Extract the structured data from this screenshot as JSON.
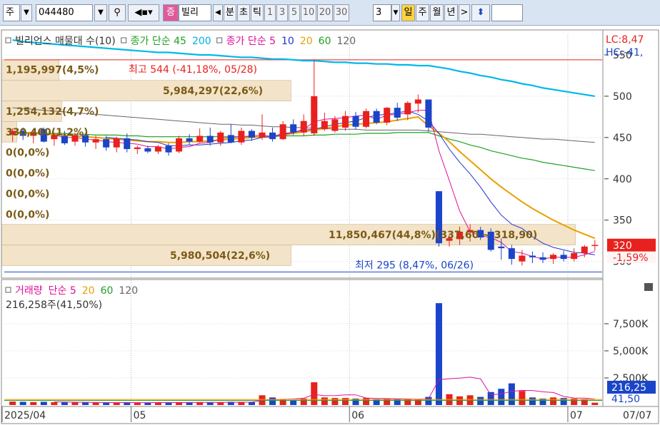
{
  "toolbar": {
    "market_btn": "주",
    "code_value": "044480",
    "stock_badge": "증",
    "stock_name": "빌리",
    "period_buttons": [
      "분",
      "초",
      "틱",
      "1",
      "3",
      "5",
      "10",
      "20",
      "30"
    ],
    "period_count": "3",
    "period_tabs": [
      "일",
      "주",
      "월",
      "년"
    ]
  },
  "legend": {
    "price_legend": [
      {
        "text": "빌리언스 매물대 수(10)",
        "color": "#333333"
      },
      {
        "text": "종가 단순 45",
        "color": "#22a022"
      },
      {
        "text": "200",
        "color": "#00b0e0"
      },
      {
        "text": "종가 단순 5",
        "color": "#e0109a"
      },
      {
        "text": "10",
        "color": "#2233cc"
      },
      {
        "text": "20",
        "color": "#e8a000"
      },
      {
        "text": "60",
        "color": "#22a022"
      },
      {
        "text": "120",
        "color": "#666666"
      }
    ],
    "lc_label": "LC:8,47",
    "hc_label": "HC:-41,"
  },
  "colors": {
    "up": "#e8211e",
    "down": "#1a45c8",
    "vp_band": "#f3e3c8",
    "ma5": "#e0109a",
    "ma10": "#2233cc",
    "ma20": "#e8a000",
    "ma60": "#22a022",
    "ma120": "#666666",
    "ma200": "#00b8e8"
  },
  "volume_profile": [
    {
      "label": "1,195,997(4,5%)",
      "pct": 4.5
    },
    {
      "label": "5,984,297(22,6%)",
      "pct": 22.6
    },
    {
      "label": "1,254,132(4,7%)",
      "pct": 4.7
    },
    {
      "label": "330,460(1,2%)",
      "pct": 1.2
    },
    {
      "label": "0(0,0%)",
      "pct": 0.0
    },
    {
      "label": "0(0,0%)",
      "pct": 0.0
    },
    {
      "label": "0(0,0%)",
      "pct": 0.0
    },
    {
      "label": "0(0,0%)",
      "pct": 0.0
    },
    {
      "label": "11,850,467(44,8%)(337,60 ~ 318,90)",
      "pct": 44.8
    },
    {
      "label": "5,980,504(22,6%)",
      "pct": 22.6
    }
  ],
  "annotations": {
    "high": "최고 544 (-41,18%, 05/28)",
    "low": "최저 295 (8,47%, 06/26)"
  },
  "price_axis": {
    "ticks": [
      "550",
      "500",
      "450",
      "400",
      "350"
    ],
    "current": "320",
    "current_pct": "-1,59%",
    "partial_tick": "300"
  },
  "volume_legend": [
    {
      "text": "거래량",
      "color": "#e0109a"
    },
    {
      "text": "단순 5",
      "color": "#e0109a"
    },
    {
      "text": "20",
      "color": "#e8a000"
    },
    {
      "text": "60",
      "color": "#22a022"
    },
    {
      "text": "120",
      "color": "#666666"
    }
  ],
  "volume_info": "216,258주(41,50%)",
  "volume_axis": {
    "ticks": [
      "7,500K",
      "5,000K",
      "2,500K"
    ],
    "current": "216,25",
    "current_pct": "41,50"
  },
  "date_axis": {
    "labels": [
      "2025/04",
      "05",
      "06",
      "07"
    ],
    "current_date": "07/07"
  },
  "chart_data": {
    "type": "candlestick",
    "price_range": [
      285,
      575
    ],
    "volume_range": [
      0,
      10000000
    ],
    "high": 544,
    "low": 295,
    "candles": [
      {
        "o": 453,
        "h": 461,
        "l": 445,
        "c": 458
      },
      {
        "o": 458,
        "h": 462,
        "l": 447,
        "c": 452
      },
      {
        "o": 452,
        "h": 459,
        "l": 443,
        "c": 456
      },
      {
        "o": 460,
        "h": 462,
        "l": 444,
        "c": 445
      },
      {
        "o": 448,
        "h": 455,
        "l": 440,
        "c": 453
      },
      {
        "o": 452,
        "h": 458,
        "l": 441,
        "c": 443
      },
      {
        "o": 445,
        "h": 456,
        "l": 440,
        "c": 453
      },
      {
        "o": 453,
        "h": 455,
        "l": 439,
        "c": 444
      },
      {
        "o": 444,
        "h": 452,
        "l": 436,
        "c": 448
      },
      {
        "o": 448,
        "h": 452,
        "l": 434,
        "c": 438
      },
      {
        "o": 438,
        "h": 451,
        "l": 432,
        "c": 449
      },
      {
        "o": 449,
        "h": 455,
        "l": 432,
        "c": 436
      },
      {
        "o": 436,
        "h": 440,
        "l": 430,
        "c": 438
      },
      {
        "o": 437,
        "h": 440,
        "l": 431,
        "c": 433
      },
      {
        "o": 433,
        "h": 441,
        "l": 430,
        "c": 439
      },
      {
        "o": 440,
        "h": 443,
        "l": 428,
        "c": 432
      },
      {
        "o": 433,
        "h": 452,
        "l": 431,
        "c": 449
      },
      {
        "o": 449,
        "h": 454,
        "l": 441,
        "c": 445
      },
      {
        "o": 445,
        "h": 461,
        "l": 444,
        "c": 452
      },
      {
        "o": 452,
        "h": 462,
        "l": 440,
        "c": 444
      },
      {
        "o": 444,
        "h": 458,
        "l": 440,
        "c": 456
      },
      {
        "o": 453,
        "h": 466,
        "l": 443,
        "c": 444
      },
      {
        "o": 444,
        "h": 462,
        "l": 441,
        "c": 458
      },
      {
        "o": 458,
        "h": 460,
        "l": 446,
        "c": 450
      },
      {
        "o": 450,
        "h": 478,
        "l": 447,
        "c": 456
      },
      {
        "o": 456,
        "h": 462,
        "l": 445,
        "c": 448
      },
      {
        "o": 448,
        "h": 470,
        "l": 447,
        "c": 466
      },
      {
        "o": 466,
        "h": 472,
        "l": 453,
        "c": 456
      },
      {
        "o": 456,
        "h": 478,
        "l": 452,
        "c": 470
      },
      {
        "o": 455,
        "h": 544,
        "l": 452,
        "c": 500
      },
      {
        "o": 460,
        "h": 480,
        "l": 458,
        "c": 470
      },
      {
        "o": 458,
        "h": 476,
        "l": 456,
        "c": 472
      },
      {
        "o": 462,
        "h": 482,
        "l": 458,
        "c": 476
      },
      {
        "o": 476,
        "h": 481,
        "l": 460,
        "c": 463
      },
      {
        "o": 463,
        "h": 485,
        "l": 461,
        "c": 482
      },
      {
        "o": 482,
        "h": 485,
        "l": 466,
        "c": 468
      },
      {
        "o": 468,
        "h": 487,
        "l": 465,
        "c": 486
      },
      {
        "o": 486,
        "h": 492,
        "l": 470,
        "c": 474
      },
      {
        "o": 478,
        "h": 494,
        "l": 471,
        "c": 492
      },
      {
        "o": 491,
        "h": 502,
        "l": 480,
        "c": 496
      },
      {
        "o": 496,
        "h": 496,
        "l": 457,
        "c": 462
      },
      {
        "o": 385,
        "h": 385,
        "l": 318,
        "c": 322
      },
      {
        "o": 325,
        "h": 332,
        "l": 318,
        "c": 328
      },
      {
        "o": 327,
        "h": 342,
        "l": 320,
        "c": 336
      },
      {
        "o": 335,
        "h": 345,
        "l": 324,
        "c": 338
      },
      {
        "o": 338,
        "h": 342,
        "l": 326,
        "c": 329
      },
      {
        "o": 336,
        "h": 340,
        "l": 312,
        "c": 314
      },
      {
        "o": 318,
        "h": 328,
        "l": 302,
        "c": 316
      },
      {
        "o": 316,
        "h": 320,
        "l": 296,
        "c": 303
      },
      {
        "o": 300,
        "h": 314,
        "l": 295,
        "c": 307
      },
      {
        "o": 307,
        "h": 312,
        "l": 298,
        "c": 305
      },
      {
        "o": 305,
        "h": 311,
        "l": 298,
        "c": 302
      },
      {
        "o": 303,
        "h": 310,
        "l": 297,
        "c": 308
      },
      {
        "o": 308,
        "h": 313,
        "l": 300,
        "c": 303
      },
      {
        "o": 303,
        "h": 316,
        "l": 300,
        "c": 310
      },
      {
        "o": 310,
        "h": 320,
        "l": 305,
        "c": 318
      },
      {
        "o": 320,
        "h": 326,
        "l": 313,
        "c": 320
      }
    ],
    "volume": [
      320000,
      300000,
      280000,
      300000,
      260000,
      250000,
      240000,
      230000,
      220000,
      200000,
      240000,
      250000,
      220000,
      200000,
      230000,
      220000,
      260000,
      240000,
      250000,
      240000,
      260000,
      300000,
      280000,
      260000,
      900000,
      700000,
      500000,
      420000,
      600000,
      2100000,
      700000,
      650000,
      650000,
      600000,
      650000,
      500000,
      600000,
      550000,
      500000,
      500000,
      750000,
      9400000,
      1000000,
      800000,
      900000,
      750000,
      1200000,
      1500000,
      2000000,
      1300000,
      700000,
      600000,
      700000,
      650000,
      600000,
      550000,
      216258
    ],
    "vol_ma5": [
      null,
      null,
      null,
      null,
      292000,
      278000,
      266000,
      256000,
      244000,
      228000,
      226000,
      232000,
      226000,
      222000,
      228000,
      228000,
      234000,
      238000,
      248000,
      242000,
      250000,
      258000,
      266000,
      268000,
      400000,
      488000,
      528000,
      556000,
      624000,
      964000,
      864000,
      874000,
      940000,
      940000,
      650000,
      610000,
      590000,
      580000,
      560000,
      530000,
      580000,
      2340000,
      2430000,
      2490000,
      2570000,
      2420000,
      930000,
      1030000,
      1270000,
      1350000,
      1340000,
      1220000,
      1160000,
      790000,
      650000,
      640000,
      543000
    ],
    "ma5": [
      null,
      null,
      null,
      null,
      453,
      450,
      450,
      448,
      447,
      445,
      444,
      443,
      442,
      439,
      439,
      436,
      438,
      439,
      443,
      444,
      449,
      450,
      451,
      452,
      453,
      451,
      455,
      456,
      460,
      469,
      472,
      473,
      474,
      476,
      477,
      472,
      477,
      478,
      480,
      483,
      483,
      434,
      398,
      361,
      336,
      331,
      329,
      323,
      312,
      310,
      306,
      303,
      305,
      305,
      305,
      308,
      312
    ],
    "ma10": [
      null,
      null,
      null,
      null,
      null,
      null,
      null,
      null,
      null,
      450,
      449,
      448,
      447,
      445,
      444,
      440,
      440,
      441,
      441,
      442,
      443,
      444,
      446,
      447,
      450,
      451,
      454,
      456,
      459,
      460,
      463,
      466,
      468,
      470,
      474,
      477,
      478,
      480,
      482,
      478,
      470,
      455,
      436,
      420,
      406,
      390,
      372,
      356,
      345,
      340,
      330,
      322,
      317,
      314,
      311,
      310,
      308
    ],
    "ma20": [
      456,
      455,
      455,
      454,
      454,
      453,
      452,
      451,
      450,
      449,
      448,
      447,
      446,
      445,
      445,
      444,
      444,
      445,
      445,
      446,
      447,
      448,
      449,
      450,
      451,
      452,
      453,
      455,
      457,
      459,
      461,
      463,
      465,
      466,
      467,
      468,
      469,
      471,
      473,
      475,
      464,
      455,
      445,
      433,
      422,
      411,
      400,
      390,
      381,
      372,
      364,
      357,
      350,
      344,
      338,
      333,
      328
    ],
    "ma60": [
      457,
      456,
      456,
      455,
      455,
      455,
      454,
      454,
      453,
      453,
      453,
      452,
      452,
      451,
      451,
      451,
      451,
      451,
      451,
      451,
      451,
      451,
      451,
      451,
      451,
      451,
      452,
      452,
      452,
      453,
      453,
      454,
      454,
      454,
      455,
      455,
      455,
      456,
      456,
      456,
      456,
      452,
      448,
      445,
      441,
      438,
      434,
      431,
      428,
      425,
      423,
      420,
      418,
      416,
      414,
      412,
      410
    ],
    "ma120": [
      486,
      485,
      484,
      483,
      482,
      481,
      480,
      479,
      478,
      477,
      476,
      475,
      474,
      473,
      472,
      471,
      470,
      469,
      468,
      467,
      466,
      466,
      465,
      465,
      464,
      463,
      463,
      462,
      462,
      461,
      461,
      460,
      460,
      460,
      459,
      459,
      459,
      459,
      459,
      459,
      458,
      457,
      456,
      455,
      454,
      454,
      453,
      452,
      451,
      450,
      449,
      448,
      448,
      447,
      446,
      445,
      444
    ],
    "ma200": [
      568,
      566,
      565,
      564,
      563,
      562,
      561,
      560,
      559,
      558,
      557,
      556,
      555,
      554,
      553,
      553,
      552,
      551,
      550,
      550,
      549,
      548,
      547,
      547,
      546,
      545,
      545,
      544,
      543,
      543,
      542,
      541,
      541,
      540,
      540,
      539,
      539,
      538,
      538,
      537,
      537,
      535,
      533,
      530,
      528,
      525,
      523,
      520,
      518,
      515,
      513,
      510,
      508,
      506,
      504,
      502,
      500
    ]
  }
}
